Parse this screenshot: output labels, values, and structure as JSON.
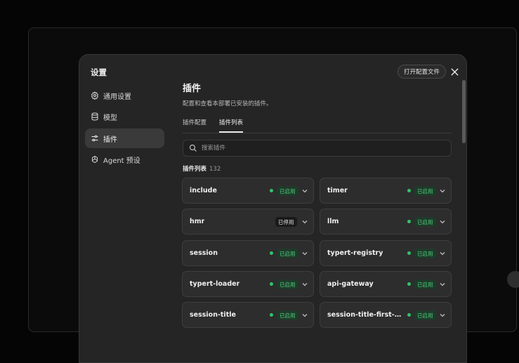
{
  "dialog": {
    "title": "设置",
    "open_config_label": "打开配置文件"
  },
  "sidebar": {
    "items": [
      {
        "label": "通用设置",
        "icon": "gear-icon"
      },
      {
        "label": "模型",
        "icon": "database-icon"
      },
      {
        "label": "插件",
        "icon": "sliders-icon",
        "active": true
      },
      {
        "label": "Agent 预设",
        "icon": "openai-icon"
      }
    ]
  },
  "main": {
    "title": "插件",
    "description": "配置和查看本部署已安装的插件。",
    "tabs": [
      {
        "label": "插件配置",
        "active": false
      },
      {
        "label": "插件列表",
        "active": true
      }
    ],
    "search_placeholder": "搜索插件",
    "list_heading": "插件列表",
    "list_count": "132"
  },
  "plugins": [
    {
      "name": "include",
      "status": "已启用",
      "enabled": true
    },
    {
      "name": "timer",
      "status": "已启用",
      "enabled": true
    },
    {
      "name": "hmr",
      "status": "已停用",
      "enabled": false
    },
    {
      "name": "llm",
      "status": "已启用",
      "enabled": true
    },
    {
      "name": "session",
      "status": "已启用",
      "enabled": true
    },
    {
      "name": "typert-registry",
      "status": "已启用",
      "enabled": true
    },
    {
      "name": "typert-loader",
      "status": "已启用",
      "enabled": true
    },
    {
      "name": "api-gateway",
      "status": "已启用",
      "enabled": true
    },
    {
      "name": "session-title",
      "status": "已启用",
      "enabled": true
    },
    {
      "name": "session-title-first-m...",
      "status": "已启用",
      "enabled": true
    }
  ],
  "colors": {
    "enabled_green": "#33c36a",
    "background": "#050505",
    "dialog": "#252525"
  }
}
